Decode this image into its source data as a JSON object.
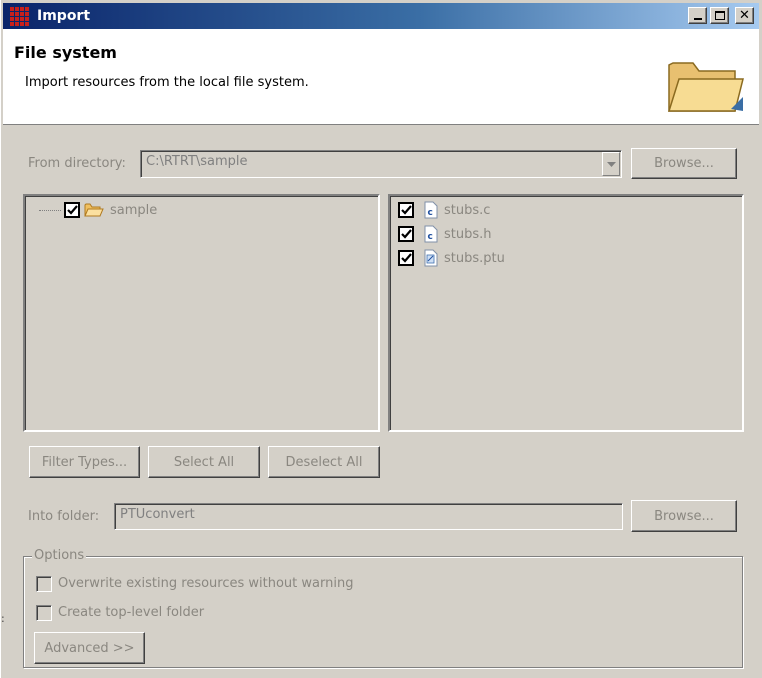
{
  "window": {
    "title": "Import",
    "min_icon": "minimize-icon",
    "max_icon": "maximize-icon",
    "close_icon": "close-icon"
  },
  "header": {
    "title": "File system",
    "description": "Import resources from the local file system."
  },
  "from_directory": {
    "label": "From directory:",
    "value": "C:\\RTRT\\sample",
    "browse_label": "Browse..."
  },
  "tree": {
    "items": [
      {
        "label": "sample",
        "checked": true,
        "icon": "folder-open-icon"
      }
    ]
  },
  "files": {
    "items": [
      {
        "label": "stubs.c",
        "checked": true,
        "icon": "c-file-icon"
      },
      {
        "label": "stubs.h",
        "checked": true,
        "icon": "c-file-icon"
      },
      {
        "label": "stubs.ptu",
        "checked": true,
        "icon": "ptu-file-icon"
      }
    ]
  },
  "buttons": {
    "filter_types": "Filter Types...",
    "select_all": "Select All",
    "deselect_all": "Deselect All"
  },
  "into_folder": {
    "label": "Into folder:",
    "value": "PTUconvert",
    "browse_label": "Browse..."
  },
  "options": {
    "title": "Options",
    "overwrite_label": "Overwrite existing resources without warning",
    "overwrite_checked": false,
    "create_folder_label": "Create top-level folder",
    "create_folder_checked": false,
    "advanced_label": "Advanced >>"
  },
  "colors": {
    "titlebar_start": "#0a246a",
    "titlebar_end": "#a6caf0",
    "dialog_bg": "#d4d0c8",
    "disabled_text": "#8a8780"
  }
}
